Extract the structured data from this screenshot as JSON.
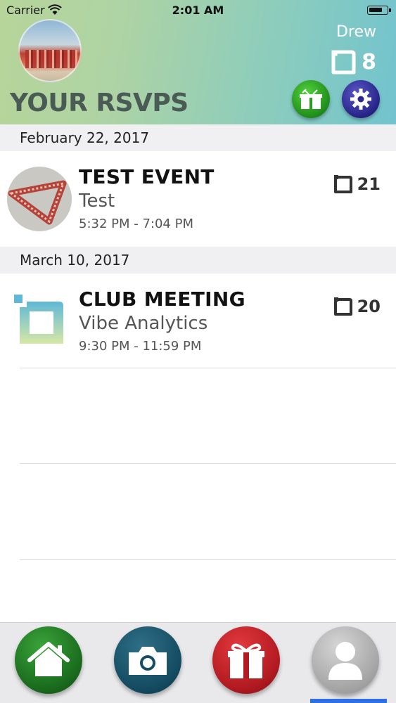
{
  "status_bar": {
    "carrier": "Carrier",
    "time": "2:01 AM"
  },
  "header": {
    "title": "YOUR RSVPS",
    "user_name": "Drew",
    "points": "8"
  },
  "sections": [
    {
      "date": "February 22, 2017",
      "events": [
        {
          "title": "TEST EVENT",
          "subtitle": "Test",
          "time": "5:32 PM - 7:04 PM",
          "points": "21"
        }
      ]
    },
    {
      "date": "March 10, 2017",
      "events": [
        {
          "title": "CLUB MEETING",
          "subtitle": "Vibe Analytics",
          "time": "9:30 PM - 11:59 PM",
          "points": "20"
        }
      ]
    }
  ],
  "tab_bar": {
    "items": [
      "home-icon",
      "camera-icon",
      "gift-icon",
      "profile-icon"
    ],
    "active": "profile"
  },
  "colors": {
    "accent_blue": "#2f6fe6",
    "home_green": "#1b6d1e",
    "camera_teal": "#154d63",
    "gift_red": "#b31b22",
    "title_gray": "#4a5a55"
  }
}
